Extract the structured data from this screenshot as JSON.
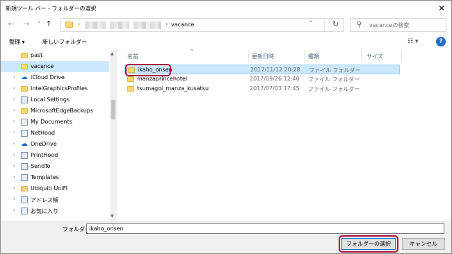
{
  "window": {
    "title": "新規ツール バー - フォルダーの選択",
    "close_glyph": "✕"
  },
  "nav": {
    "back_glyph": "←",
    "forward_glyph": "→",
    "recent_glyph": "˅",
    "up_glyph": "↑",
    "address_crumb": "vacance",
    "address_arrow": "›",
    "dropdown_glyph": "˅",
    "refresh_glyph": "↻",
    "search_placeholder": "vacanceの検索",
    "search_glyph": "⚲"
  },
  "toolbar": {
    "organize_label": "整理 ▾",
    "new_folder_label": "新しいフォルダー",
    "view_glyph": "☷ ▾",
    "help_label": "?"
  },
  "tree": {
    "items": [
      {
        "label": "past",
        "icon": "folder-icon"
      },
      {
        "label": "vacance",
        "icon": "folder-icon",
        "selected": true
      },
      {
        "label": "iCloud Drive",
        "icon": "cloud-icon"
      },
      {
        "label": "IntelGraphicsProfiles",
        "icon": "folder-icon"
      },
      {
        "label": "Local Settings",
        "icon": "shortcut-icon"
      },
      {
        "label": "MicrosoftEdgeBackups",
        "icon": "folder-icon"
      },
      {
        "label": "My Documents",
        "icon": "shortcut-icon"
      },
      {
        "label": "NetHood",
        "icon": "shortcut-icon"
      },
      {
        "label": "OneDrive",
        "icon": "cloud-icon"
      },
      {
        "label": "PrintHood",
        "icon": "shortcut-icon"
      },
      {
        "label": "SendTo",
        "icon": "shortcut-icon"
      },
      {
        "label": "Templates",
        "icon": "shortcut-icon"
      },
      {
        "label": "Ubiquiti UniFi",
        "icon": "folder-icon"
      },
      {
        "label": "アドレス帳",
        "icon": "contacts-icon"
      },
      {
        "label": "お気に入り",
        "icon": "favorites-icon"
      }
    ],
    "chevron_glyph": "›",
    "scroll_up_glyph": "▲",
    "scroll_down_glyph": "▼"
  },
  "list": {
    "columns": {
      "name": "名前",
      "date": "更新日時",
      "type": "種類",
      "size": "サイズ"
    },
    "sort_caret": "^",
    "rows": [
      {
        "name": "ikaho_onsen",
        "date": "2017/11/12 20:28",
        "type": "ファイル フォルダー",
        "selected": true
      },
      {
        "name": "manzaprincehotel",
        "date": "2017/09/26 12:40",
        "type": "ファイル フォルダー"
      },
      {
        "name": "tsumagoi_manza_kusatsu",
        "date": "2017/07/03 17:45",
        "type": "ファイル フォルダー"
      }
    ]
  },
  "footer": {
    "folder_label": "フォルダー:",
    "folder_value": "ikaho_onsen",
    "select_button": "フォルダーの選択",
    "cancel_button": "キャンセル"
  },
  "colors": {
    "selection": "#cce8ff",
    "highlight_border": "#a8123c",
    "folder_yellow": "#f8d775"
  }
}
